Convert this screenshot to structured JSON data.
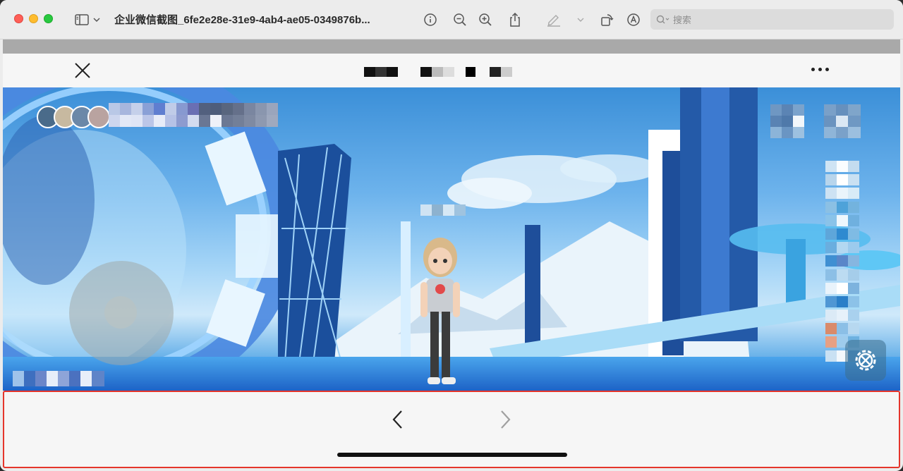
{
  "window": {
    "title": "企业微信截图_6fe2e28e-31e9-4ab4-ae05-0349876b...",
    "search_placeholder": "搜索"
  },
  "toolbar": {
    "icons": [
      "sidebar-icon",
      "chevron-down-icon",
      "info-icon",
      "zoom-out-icon",
      "zoom-in-icon",
      "share-icon",
      "markup-pen-icon",
      "chevron-down-icon",
      "rotate-icon",
      "annotate-icon",
      "search-icon"
    ]
  },
  "app_header": {
    "close_icon": "close-icon",
    "more_icon": "more-icon"
  },
  "scene": {
    "joystick": "joystick",
    "settings_icon": "gear-wrench-icon"
  },
  "bottom_nav": {
    "back_icon": "chevron-left-icon",
    "forward_icon": "chevron-right-icon"
  },
  "colors": {
    "highlight_border": "#e5352b",
    "sky": "#6db3ec"
  }
}
